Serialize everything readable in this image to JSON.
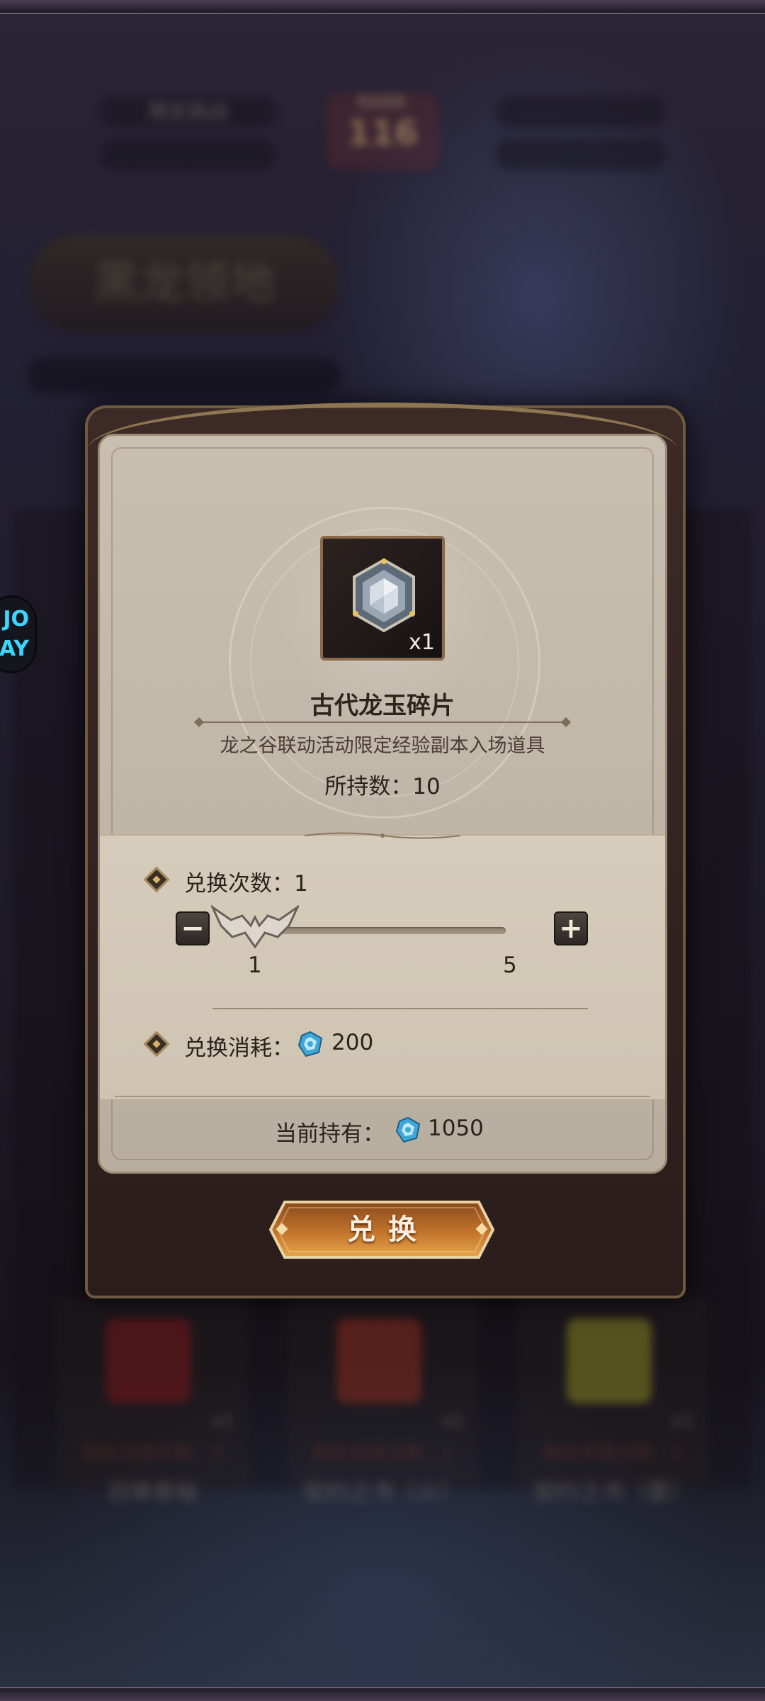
{
  "background": {
    "top_left_pill": "限定挑战",
    "rank_label": "RANK",
    "rank_value": "116",
    "region_title": "黑龙领地",
    "cards": [
      {
        "quantity": "x1",
        "remaining": "剩余兑换次数：5",
        "name": "召唤卷轴"
      },
      {
        "quantity": "x1",
        "remaining": "剩余兑换次数：1",
        "name": "契约之书（火）"
      },
      {
        "quantity": "x1",
        "remaining": "剩余兑换次数：1",
        "name": "契约之书（雷）"
      }
    ]
  },
  "dialog": {
    "item": {
      "icon": "dragon-jade-shard-icon",
      "quantity": "x1",
      "name": "古代龙玉碎片",
      "description": "龙之谷联动活动限定经验副本入场道具",
      "owned": "所持数：10"
    },
    "exchange_count": {
      "label": "兑换次数：1",
      "value": 1,
      "min": "1",
      "max": "5",
      "decrease_symbol": "−",
      "increase_symbol": "+"
    },
    "cost": {
      "label": "兑换消耗：",
      "currency_icon": "blue-crystal-icon",
      "amount": "200"
    },
    "current_held": {
      "label": "当前持有：",
      "currency_icon": "blue-crystal-icon",
      "amount": "1050"
    },
    "exchange_button": "兑换"
  },
  "colors": {
    "parchment": "#c9bfb0",
    "frame": "#3c2a26",
    "button_orange": "#c2742c",
    "text_dark": "#2a221b"
  }
}
